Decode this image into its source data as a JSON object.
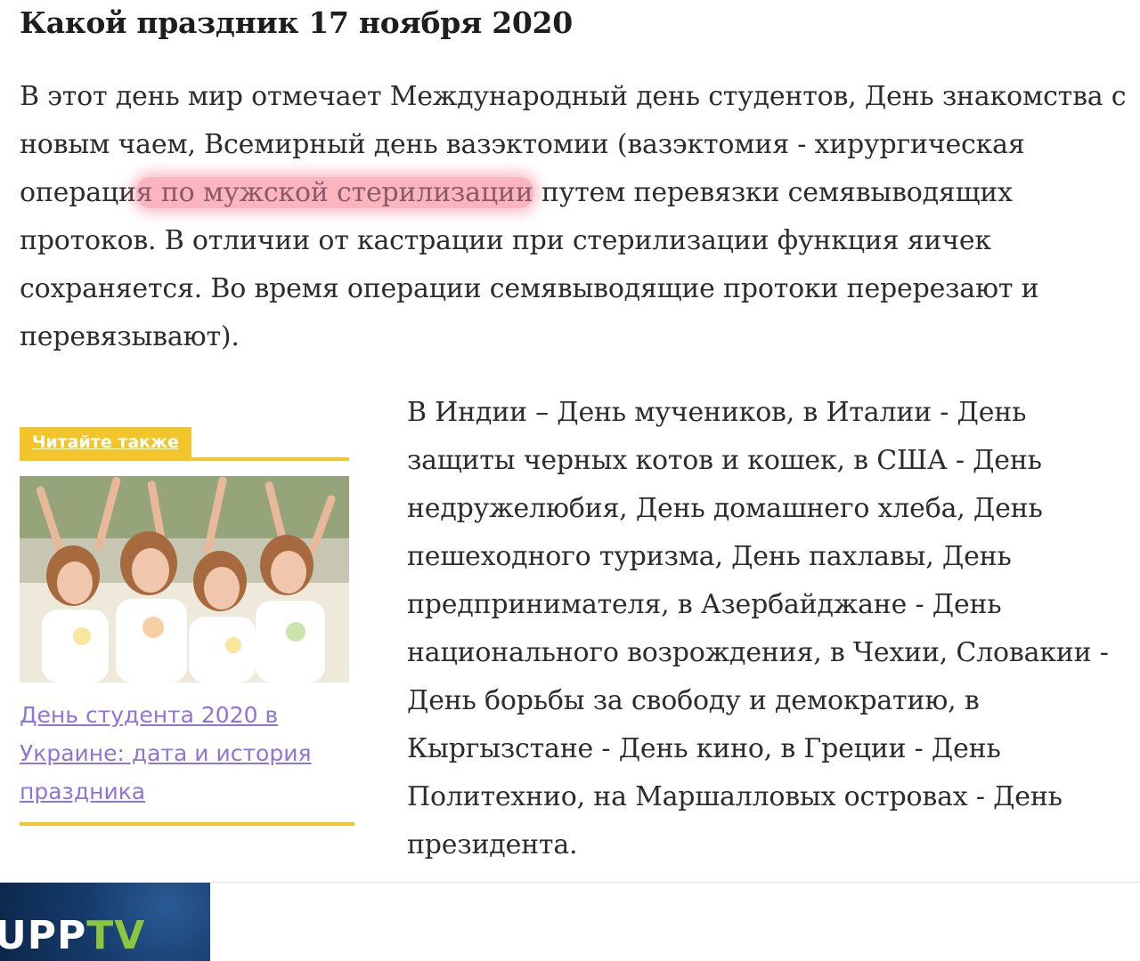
{
  "article": {
    "heading": "Какой праздник 17 ноября 2020",
    "lead": {
      "before": "В этот день мир отмечает Международный день студентов, День знакомства с новым чаем, Всемирный день вазэктомии (вазэктомия - хирургическая операци",
      "highlight": "я по мужской стерилизации",
      "after": " путем перевязки семявыводящих протоков. В отличии от кастрации при стерилизации функция яичек сохраняется. Во время операции семявыводящие протоки перерезают и перевязывают)."
    },
    "body": "В Индии – День мучеников, в Италии - День защиты черных котов и кошек, в США - День недружелюбия, День домашнего хлеба, День пешеходного туризма, День пахлавы, День предпринимателя, в Азербайджане - День национального возрождения, в Чехии, Словакии - День борьбы за свободу и демократию, в Кыргызстане - День кино, в Греции - День Политехнио, на Маршалловых островах - День президента."
  },
  "read_also": {
    "label": "Читайте также",
    "link_text": "День студента 2020 в Украине: дата и история праздника"
  },
  "ad": {
    "logo_main": "UPP",
    "logo_accent": "TV"
  },
  "colors": {
    "accent_yellow": "#f2c52a",
    "link_purple": "#8e76d8",
    "highlight_pink": "#f5788c",
    "logo_green": "#8cc63f"
  }
}
